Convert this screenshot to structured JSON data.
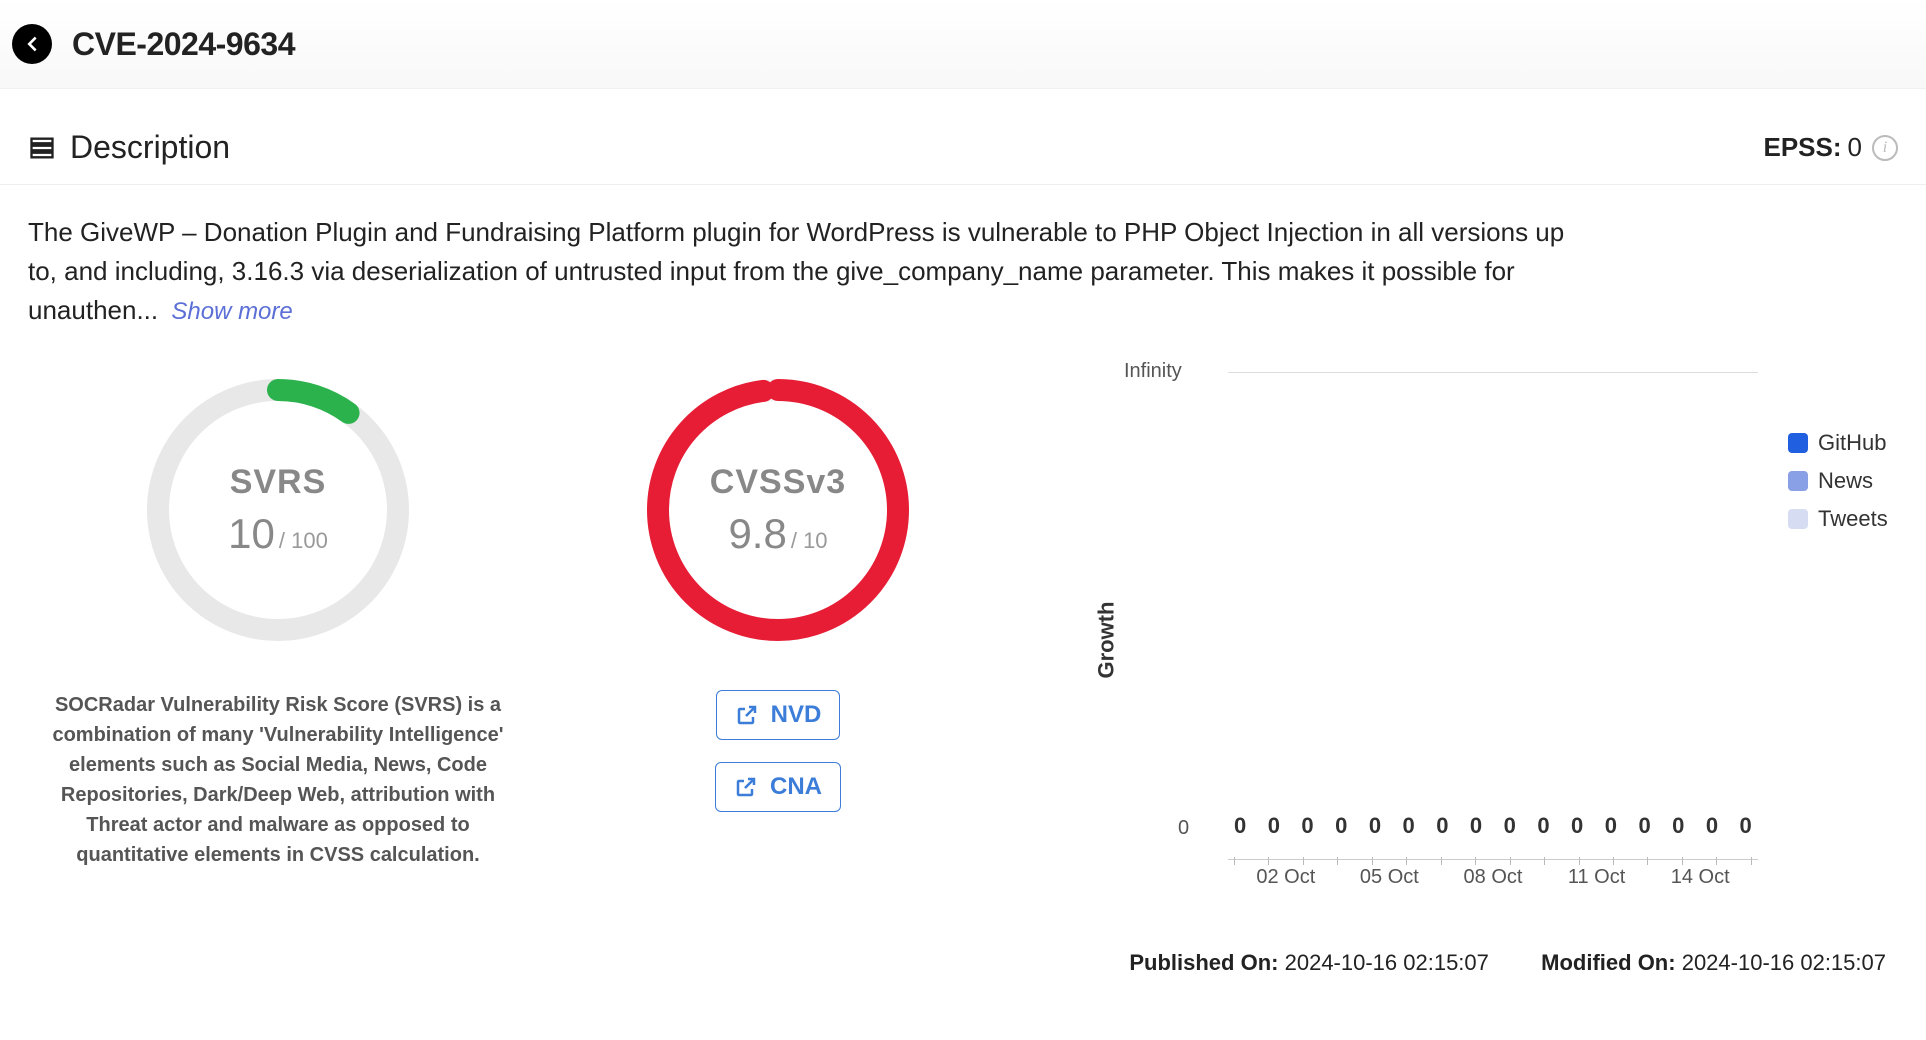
{
  "header": {
    "title": "CVE-2024-9634"
  },
  "description": {
    "section_label": "Description",
    "text": "The GiveWP – Donation Plugin and Fundraising Platform plugin for WordPress is vulnerable to PHP Object Injection in all versions up to, and including, 3.16.3 via deserialization of untrusted input from the give_company_name parameter. This makes it possible for unauthen...",
    "show_more": "Show more"
  },
  "epss": {
    "label": "EPSS:",
    "value": "0"
  },
  "svrs": {
    "label": "SVRS",
    "value": "10",
    "max": "/ 100",
    "percent": 10,
    "color": "#2bb24c",
    "note": "SOCRadar Vulnerability Risk Score (SVRS) is a combination of many 'Vulnerability Intelligence' elements such as Social Media, News, Code Repositories, Dark/Deep Web, attribution with Threat actor and malware as opposed to quantitative elements in CVSS calculation."
  },
  "cvss": {
    "label": "CVSSv3",
    "value": "9.8",
    "max": "/ 10",
    "percent": 98,
    "color": "#e71d36",
    "links": {
      "nvd": "NVD",
      "cna": "CNA"
    }
  },
  "chart_data": {
    "type": "line",
    "title": "",
    "ylabel": "Growth",
    "xlabel": "",
    "y_top": "Infinity",
    "y_bottom": "0",
    "x_ticks": [
      "02 Oct",
      "05 Oct",
      "08 Oct",
      "11 Oct",
      "14 Oct"
    ],
    "bar_labels": [
      "0",
      "0",
      "0",
      "0",
      "0",
      "0",
      "0",
      "0",
      "0",
      "0",
      "0",
      "0",
      "0",
      "0",
      "0",
      "0"
    ],
    "series": [
      {
        "name": "GitHub",
        "color": "#1f5fe0",
        "values": [
          0,
          0,
          0,
          0,
          0,
          0,
          0,
          0,
          0,
          0,
          0,
          0,
          0,
          0,
          0,
          0
        ]
      },
      {
        "name": "News",
        "color": "#8aa0e6",
        "values": [
          0,
          0,
          0,
          0,
          0,
          0,
          0,
          0,
          0,
          0,
          0,
          0,
          0,
          0,
          0,
          0
        ]
      },
      {
        "name": "Tweets",
        "color": "#d6dcf2",
        "values": [
          0,
          0,
          0,
          0,
          0,
          0,
          0,
          0,
          0,
          0,
          0,
          0,
          0,
          0,
          0,
          0
        ]
      }
    ]
  },
  "dates": {
    "published_label": "Published On:",
    "published_value": "2024-10-16 02:15:07",
    "modified_label": "Modified On:",
    "modified_value": "2024-10-16 02:15:07"
  }
}
